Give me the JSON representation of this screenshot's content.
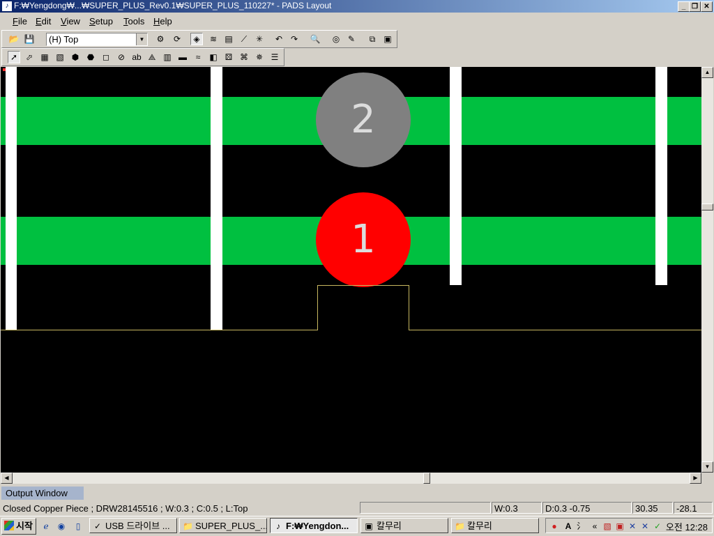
{
  "window": {
    "title": "F:₩Yengdong₩...₩SUPER_PLUS_Rev0.1₩SUPER_PLUS_110227* - PADS Layout",
    "minimize": "_",
    "maximize": "❐",
    "close": "✕"
  },
  "menu": [
    {
      "label": "File",
      "key": "F",
      "rest": "ile"
    },
    {
      "label": "Edit",
      "key": "E",
      "rest": "dit"
    },
    {
      "label": "View",
      "key": "V",
      "rest": "iew"
    },
    {
      "label": "Setup",
      "key": "S",
      "rest": "etup"
    },
    {
      "label": "Tools",
      "key": "T",
      "rest": "ools"
    },
    {
      "label": "Help",
      "key": "H",
      "rest": "elp"
    }
  ],
  "toolbar": {
    "layer_value": "(H) Top"
  },
  "canvas": {
    "pad_top_label": "2",
    "pad_bottom_label": "1",
    "colors": {
      "trace": "#00c040",
      "pad_top": "#808080",
      "pad_bottom": "#ff0000",
      "outline": "#c8b860"
    }
  },
  "output_window": {
    "tab_label": "Output Window"
  },
  "status": {
    "text": "Closed Copper Piece ; DRW28145516 ; W:0.3 ; C:0.5 ; L:Top",
    "field_blank": "",
    "width": "W:0.3",
    "delta": "D:0.3 -0.75",
    "x": "30.35",
    "y": "-28.1"
  },
  "taskbar": {
    "start_label": "시작",
    "tasks": [
      {
        "label": "USB 드라이브 ...",
        "icon": "✓"
      },
      {
        "label": "SUPER_PLUS_...",
        "icon": "📁"
      },
      {
        "label": "F:₩Yengdon...",
        "icon": "♪"
      },
      {
        "label": "칼무리",
        "icon": "▣"
      },
      {
        "label": "칼무리",
        "icon": "📁"
      }
    ],
    "clock": "오전 12:28",
    "tray_lang": "A",
    "tray_chevron": "«"
  }
}
